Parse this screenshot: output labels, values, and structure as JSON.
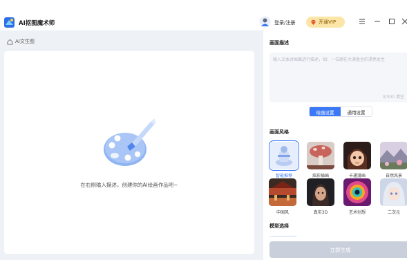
{
  "app": {
    "title": "AI抠图魔术师"
  },
  "header": {
    "login_label": "登录/注册",
    "vip_label": "开通VIP"
  },
  "breadcrumb": {
    "label": "AI文生图"
  },
  "canvas": {
    "hint": "在右侧输入描述，创建你的AI绘画作品吧~"
  },
  "panel": {
    "description_title": "画面描述",
    "prompt_placeholder": "输入文本对画面进行描述，如：一位踏在大漠盘坐的漂亮女生",
    "prompt_value": "",
    "char_count": "0/300",
    "clear_label": "清空",
    "tabs": [
      {
        "label": "绘画设置",
        "active": true
      },
      {
        "label": "通用设置",
        "active": false
      }
    ],
    "style_title": "画面风格",
    "styles": [
      {
        "label": "智能推荐",
        "selected": true
      },
      {
        "label": "炫彩插画",
        "selected": false
      },
      {
        "label": "卡通漫画",
        "selected": false
      },
      {
        "label": "自然风景",
        "selected": false
      },
      {
        "label": "中国风",
        "selected": false
      },
      {
        "label": "真实3D",
        "selected": false
      },
      {
        "label": "艺术创想",
        "selected": false
      },
      {
        "label": "二次元",
        "selected": false
      }
    ],
    "model_title": "模型选择",
    "generate_label": "立即生成"
  },
  "colors": {
    "accent": "#3b78f5",
    "vip_bg": "#fbe6a7",
    "generate_disabled": "#c9cfdb",
    "page_bg": "#eef1f5"
  },
  "icons": {
    "logo": "app-logo-icon",
    "avatar": "user-avatar-icon",
    "vip": "diamond-icon",
    "menu": "menu-icon",
    "minimize": "minimize-icon",
    "maximize": "maximize-icon",
    "close": "close-icon",
    "breadcrumb": "home-icon",
    "illustration": "paint-palette-icon"
  }
}
